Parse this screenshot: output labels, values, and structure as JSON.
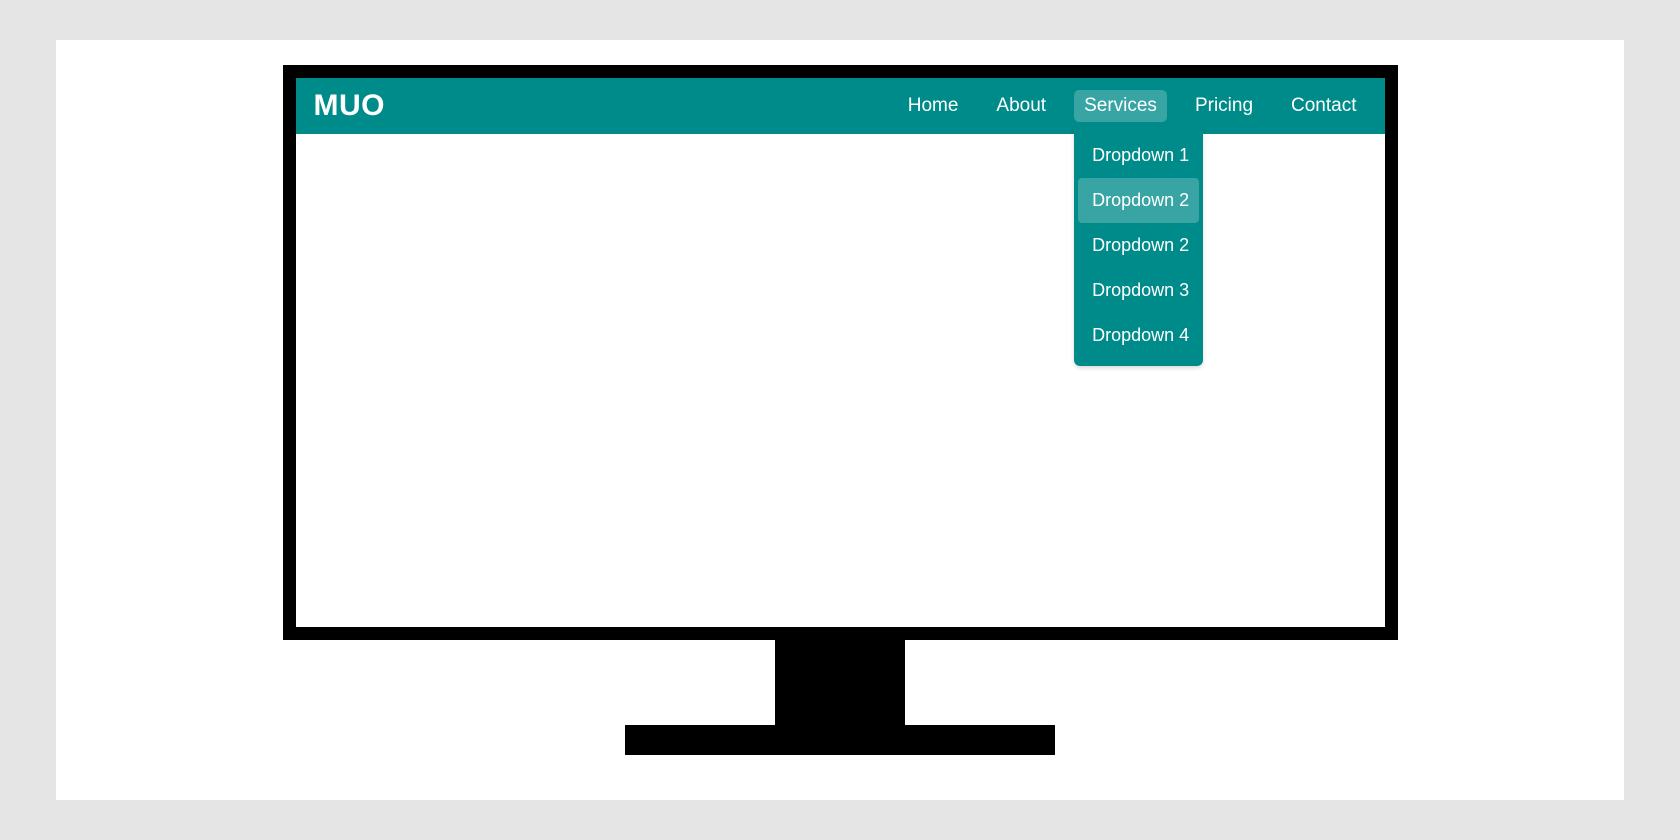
{
  "brand": "MUO",
  "nav": {
    "items": [
      {
        "label": "Home",
        "active": false,
        "dropdown": null
      },
      {
        "label": "About",
        "active": false,
        "dropdown": null
      },
      {
        "label": "Services",
        "active": true,
        "dropdown": [
          {
            "label": "Dropdown 1",
            "hovered": false
          },
          {
            "label": "Dropdown 2",
            "hovered": true
          },
          {
            "label": "Dropdown 2",
            "hovered": false
          },
          {
            "label": "Dropdown 3",
            "hovered": false
          },
          {
            "label": "Dropdown 4",
            "hovered": false
          }
        ]
      },
      {
        "label": "Pricing",
        "active": false,
        "dropdown": null
      },
      {
        "label": "Contact",
        "active": false,
        "dropdown": null
      }
    ]
  },
  "colors": {
    "navbar_bg": "#008B8B",
    "highlight": "rgba(255,255,255,0.22)",
    "page_bg": "#e5e5e5"
  }
}
